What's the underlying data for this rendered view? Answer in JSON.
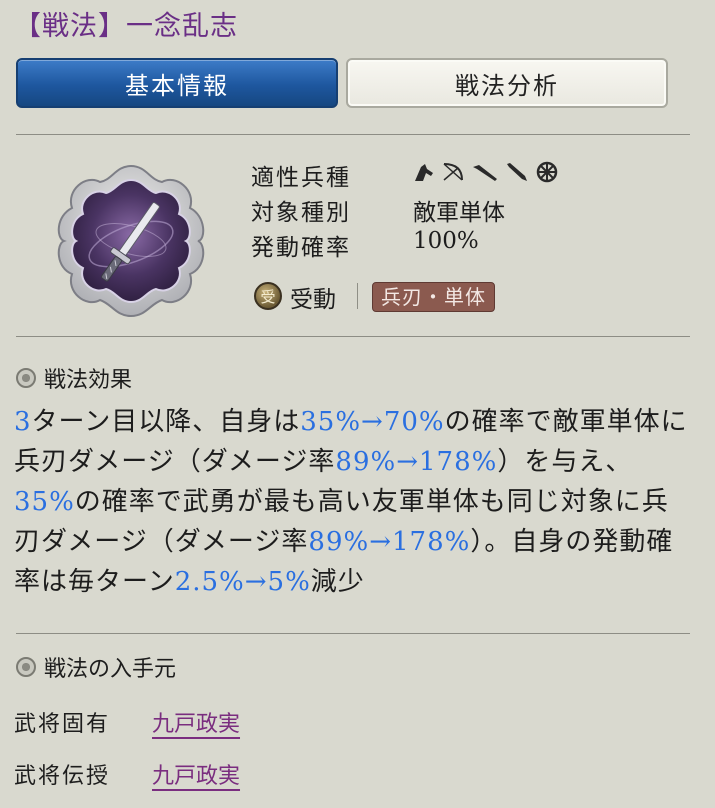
{
  "header": {
    "title": "【戦法】一念乱志"
  },
  "tabs": [
    {
      "label": "基本情報",
      "active": true
    },
    {
      "label": "戦法分析",
      "active": false
    }
  ],
  "info": {
    "troop_label": "適性兵種",
    "troop_icons": [
      "cavalry-icon",
      "bow-icon",
      "spear-icon",
      "gun-icon",
      "shield-wheel-icon"
    ],
    "target_label": "対象種別",
    "target_value": "敵軍単体",
    "rate_label": "発動確率",
    "rate_value": "100%",
    "type_badge": "受",
    "type_label": "受動",
    "damage_tag": "兵刃・単体"
  },
  "effect": {
    "heading": "戦法効果",
    "parts": [
      {
        "text": "3",
        "hl": true
      },
      {
        "text": "ターン目以降、自身は",
        "hl": false
      },
      {
        "text": "35%→70%",
        "hl": true
      },
      {
        "text": "の確率で敵軍単体に兵刃ダメージ（ダメージ率",
        "hl": false
      },
      {
        "text": "89%→178%",
        "hl": true
      },
      {
        "text": "）を与え、",
        "hl": false
      },
      {
        "text": "35%",
        "hl": true
      },
      {
        "text": "の確率で武勇が最も高い友軍単体も同じ対象に兵刃ダメージ（ダメージ率",
        "hl": false
      },
      {
        "text": "89%→178%",
        "hl": true
      },
      {
        "text": "）。自身の発動確率は毎ターン",
        "hl": false
      },
      {
        "text": "2.5%→5%",
        "hl": true
      },
      {
        "text": "減少",
        "hl": false
      }
    ]
  },
  "sources": {
    "heading": "戦法の入手元",
    "items": [
      {
        "label": "武将固有",
        "value": "九戸政実"
      },
      {
        "label": "武将伝授",
        "value": "九戸政実"
      }
    ]
  },
  "colors": {
    "background": "#d9d9cf",
    "title": "#6a2f86",
    "active_tab": "#1e579f",
    "highlight": "#2a6fe0",
    "link": "#7a2d7f",
    "tag": "#8b5a4f"
  }
}
